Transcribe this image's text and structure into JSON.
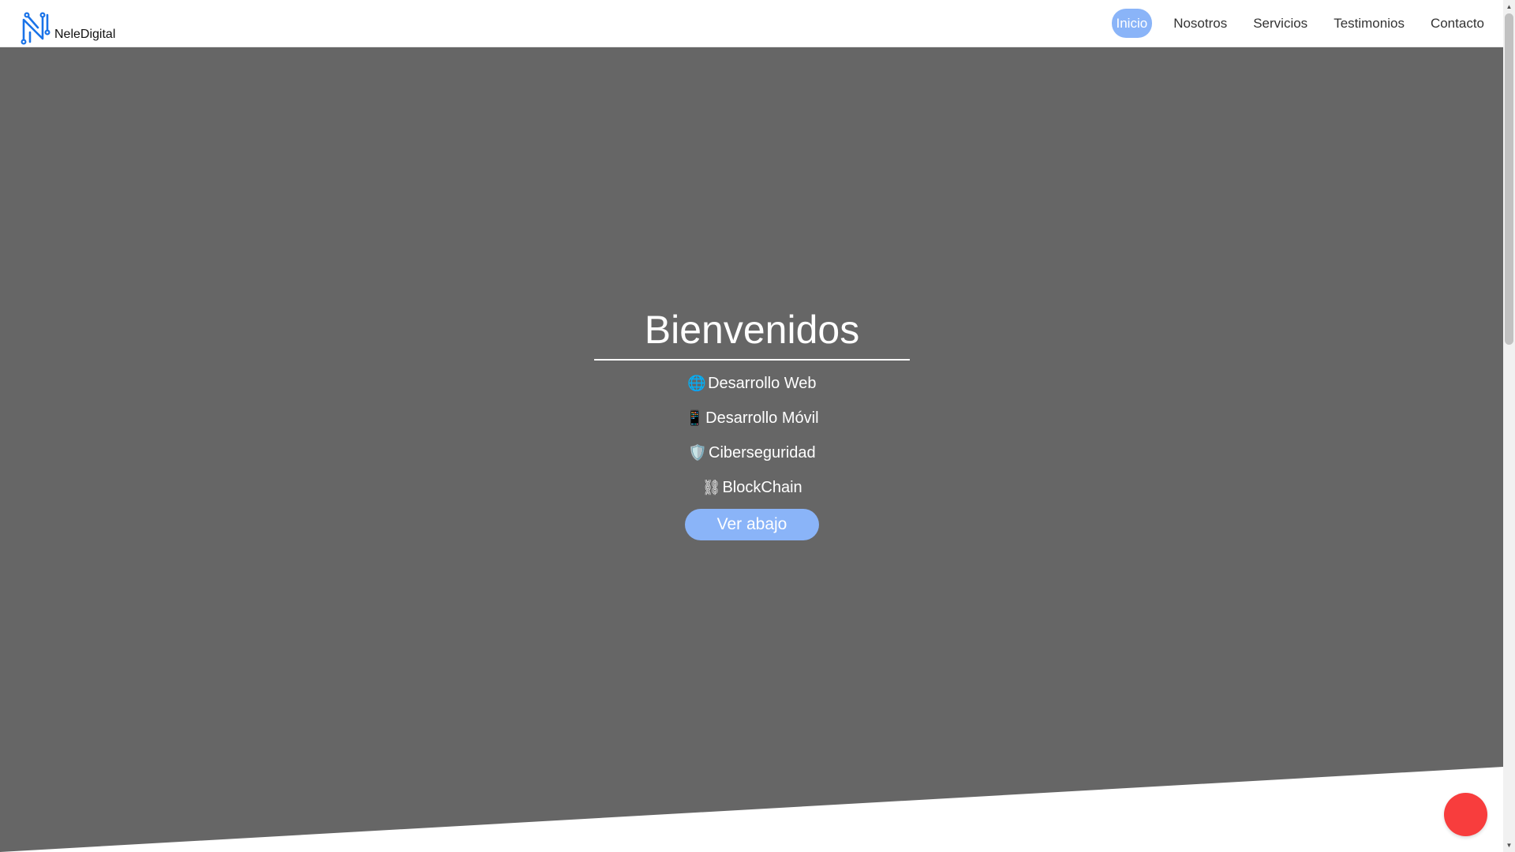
{
  "brand": {
    "logo_icon": "n-circuit-logo-icon",
    "name": "NeleDigital"
  },
  "nav": {
    "items": [
      {
        "label": "Inicio",
        "active": true
      },
      {
        "label": "Nosotros"
      },
      {
        "label": "Servicios"
      },
      {
        "label": "Testimonios"
      },
      {
        "label": "Contacto"
      }
    ]
  },
  "hero": {
    "title": "Bienvenidos",
    "services": [
      {
        "emoji": "🌐",
        "icon": "globe-icon",
        "label": "Desarrollo Web"
      },
      {
        "emoji": "📱",
        "icon": "mobile-phone-icon",
        "label": "Desarrollo Móvil"
      },
      {
        "emoji": "🛡️",
        "icon": "shield-icon",
        "label": "Ciberseguridad"
      },
      {
        "emoji": "⛓",
        "icon": "chain-icon",
        "label": "BlockChain"
      }
    ],
    "cta_label": "Ver abajo"
  },
  "colors": {
    "accent": "#8ab4f8",
    "hero_background": "#666666",
    "floating_button": "#f83d3d",
    "logo": "#1a73e8"
  },
  "floating_button": {
    "name": "floating-action-button"
  },
  "scrollbar": {
    "up_arrow": "▲",
    "down_arrow": "▼"
  }
}
